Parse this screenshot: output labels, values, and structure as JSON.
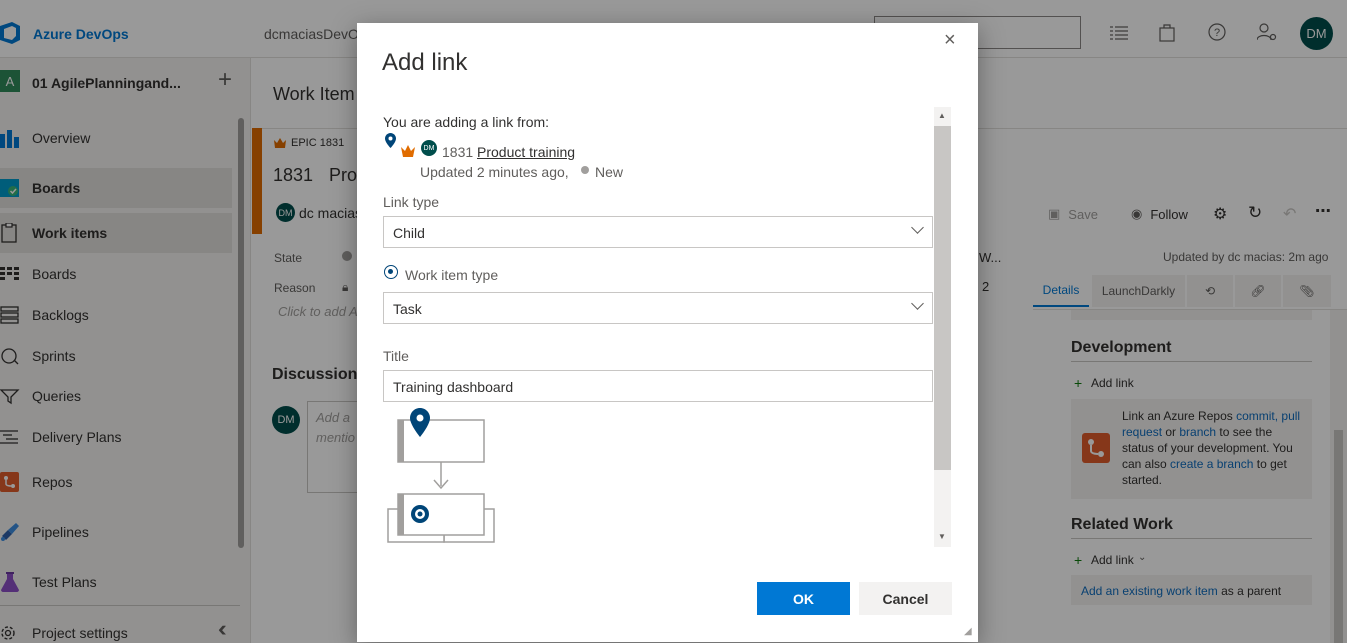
{
  "topbar": {
    "brand": "Azure DevOps",
    "org": "dcmaciasDevO",
    "avatar": "DM"
  },
  "sidebar": {
    "project_initial": "A",
    "project_name": "01 AgilePlanningand...",
    "items": [
      {
        "label": "Overview"
      },
      {
        "label": "Boards"
      },
      {
        "label": "Work items"
      },
      {
        "label": "Boards"
      },
      {
        "label": "Backlogs"
      },
      {
        "label": "Sprints"
      },
      {
        "label": "Queries"
      },
      {
        "label": "Delivery Plans"
      },
      {
        "label": "Repos"
      },
      {
        "label": "Pipelines"
      },
      {
        "label": "Test Plans"
      },
      {
        "label": "Project settings"
      }
    ]
  },
  "page": {
    "header": "Work Item",
    "epic_badge": "EPIC 1831",
    "title_id": "1831",
    "title_frag": "Pro",
    "assignee_avatar": "DM",
    "assignee_frag": "dc macias",
    "state_label": "State",
    "reason_label": "Reason",
    "click_to_add": "Click to add A",
    "discussion": "Discussion",
    "comment_avatar": "DM",
    "comment_ph_1": "Add a",
    "comment_ph_2": "mentio",
    "w_frag": "W...",
    "two": "2",
    "save": "Save",
    "follow": "Follow",
    "updated_by": "Updated by dc macias: 2m ago",
    "tabs": {
      "details": "Details",
      "launchdarkly": "LaunchDarkly"
    },
    "development": "Development",
    "add_link": "Add link",
    "dev_text_1": "Link an Azure Repos ",
    "dev_link_commit": "commit,",
    "dev_link_pr": "pull request",
    "dev_text_or": " or ",
    "dev_link_branch": "branch",
    "dev_text_2": " to see the status of your development. You can also ",
    "dev_link_create": "create a branch",
    "dev_text_3": " to get started.",
    "related": "Related Work",
    "add_link2": "Add link",
    "rel_link": "Add an existing work item",
    "rel_text": " as a parent"
  },
  "dialog": {
    "title": "Add link",
    "from_label": "You are adding a link from:",
    "from_avatar": "DM",
    "from_id": "1831",
    "from_title": "Product training",
    "from_meta": "Updated 2 minutes ago,",
    "from_state": "New",
    "link_type_label": "Link type",
    "link_type_value": "Child",
    "wit_label": "Work item type",
    "wit_value": "Task",
    "title_label": "Title",
    "title_value": "Training dashboard",
    "ok": "OK",
    "cancel": "Cancel"
  },
  "colors": {
    "accent": "#0078d4",
    "epic": "#e06c00",
    "teal": "#004e4c"
  }
}
